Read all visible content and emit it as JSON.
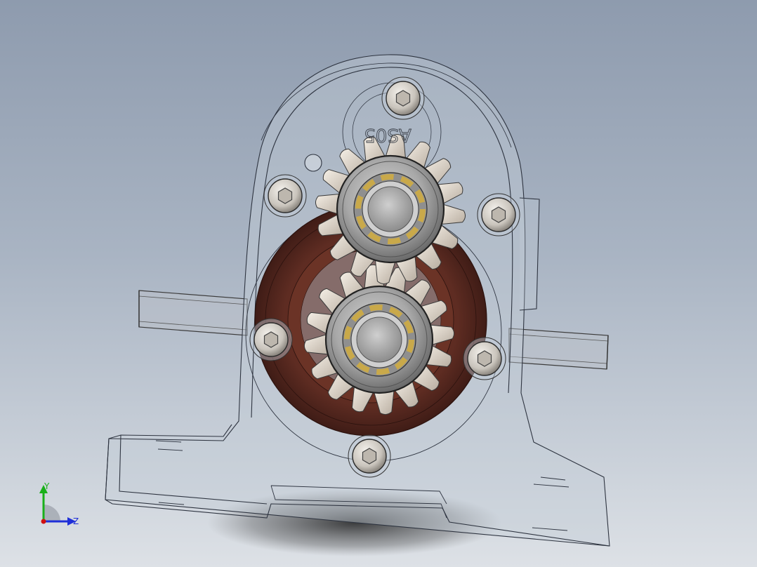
{
  "engraving": {
    "text": "AS05"
  },
  "triad": {
    "y_label": "Y",
    "z_label": "Z"
  },
  "colors": {
    "background_top": "#8e9bae",
    "background_bottom": "#dde1e6",
    "housing_tint": "#c4ccd6",
    "seal_brown": "#5e2c22",
    "gear_tooth": "#e8e0d6",
    "bearing_steel": "#a8a8a8",
    "bearing_balls": "#c9a94a",
    "triad_y": "#19b019",
    "triad_z": "#1f2fd8",
    "triad_origin": "#d01010"
  },
  "parts": [
    "housing",
    "input-shaft",
    "output-shaft",
    "seal-ring",
    "upper-gear",
    "lower-gear",
    "upper-bearing",
    "lower-bearing",
    "cap-screws"
  ]
}
